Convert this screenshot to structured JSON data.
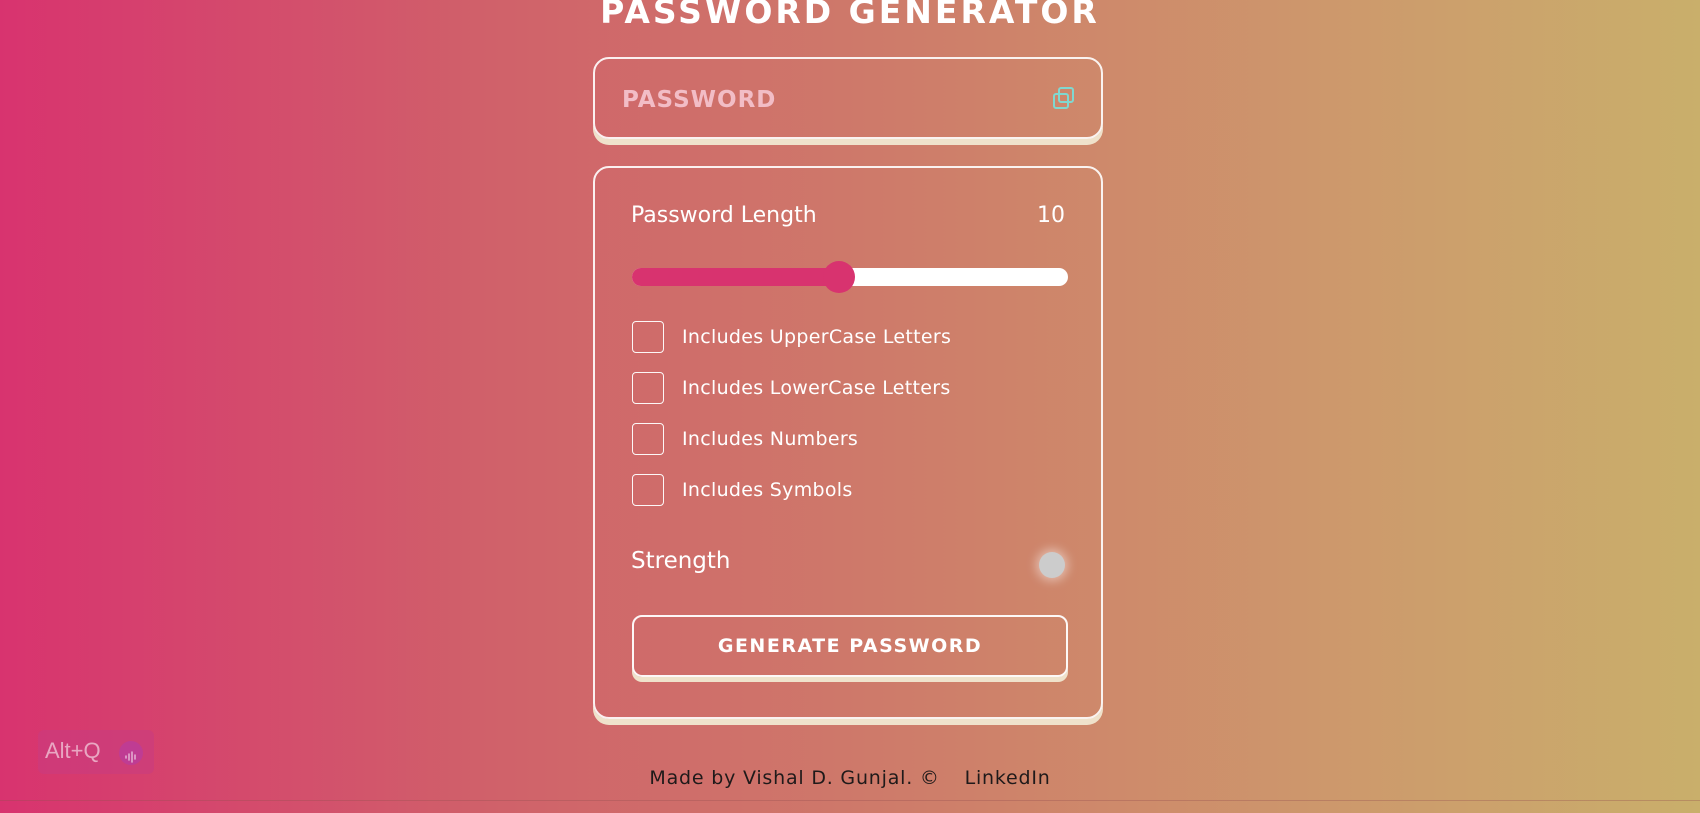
{
  "title": "PASSWORD GENERATOR",
  "display": {
    "placeholder": "PASSWORD",
    "copy_icon": "copy-icon"
  },
  "settings": {
    "length_label": "Password Length",
    "length_value": "10",
    "slider": {
      "min": 1,
      "max": 20,
      "value": 10,
      "fill_color": "#d8336f",
      "track_color": "#ffffff"
    },
    "options": [
      {
        "label": "Includes UpperCase Letters",
        "checked": false
      },
      {
        "label": "Includes LowerCase Letters",
        "checked": false
      },
      {
        "label": "Includes Numbers",
        "checked": false
      },
      {
        "label": "Includes Symbols",
        "checked": false
      }
    ],
    "strength_label": "Strength",
    "strength_color": "#cccccc",
    "generate_label": "GENERATE PASSWORD"
  },
  "footer": {
    "credit": "Made by Vishal D. Gunjal. ©",
    "link": "LinkedIn"
  },
  "hotkey": {
    "label": "Alt+Q",
    "icon": "waveform-icon"
  },
  "colors": {
    "accent": "#d8336f",
    "button_shadow": "#efe2cb",
    "placeholder_text": "#f2bdc6",
    "copy_icon": "#7fd8d0"
  }
}
